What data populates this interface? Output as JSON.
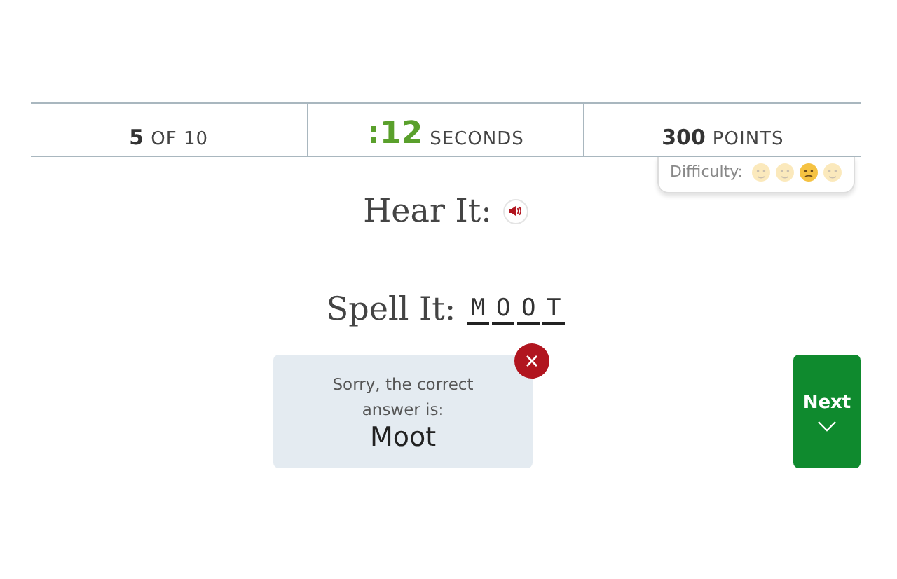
{
  "stats": [
    {
      "value": "5",
      "unit": "OF 10",
      "highlight": false
    },
    {
      "value": ":12",
      "unit": "SECONDS",
      "highlight": true
    },
    {
      "value": "300",
      "unit": "POINTS",
      "highlight": false
    }
  ],
  "difficulty": {
    "label": "Difficulty:",
    "levels": [
      {
        "selected": false
      },
      {
        "selected": false
      },
      {
        "selected": true
      },
      {
        "selected": false
      }
    ]
  },
  "hear": {
    "label": "Hear It:"
  },
  "spell": {
    "label": "Spell It:",
    "letters": [
      "M",
      "O",
      "O",
      "T"
    ]
  },
  "feedback": {
    "message": "Sorry, the correct answer is:",
    "answer": "Moot"
  },
  "next_button": {
    "label": "Next"
  }
}
